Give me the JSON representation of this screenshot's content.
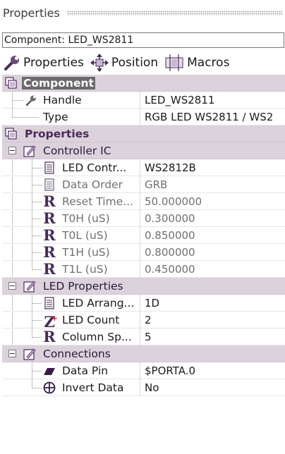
{
  "panel": {
    "title": "Properties"
  },
  "component_selector": {
    "value": "Component: LED_WS2811"
  },
  "tabs": [
    {
      "label": "Properties",
      "icon": "wrench-icon"
    },
    {
      "label": "Position",
      "icon": "move-arrows-icon"
    },
    {
      "label": "Macros",
      "icon": "macro-icon"
    }
  ],
  "component": {
    "label": "Component",
    "rows": [
      {
        "name": "Handle",
        "value": "LED_WS2811",
        "icon": "wrench-small-icon"
      },
      {
        "name": "Type",
        "value": "RGB LED WS2811 / WS2"
      }
    ]
  },
  "properties": {
    "label": "Properties",
    "groups": [
      {
        "label": "Controller IC",
        "rows": [
          {
            "name": "LED Contr...",
            "value": "WS2812B",
            "icon": "list-icon",
            "disabled": false
          },
          {
            "name": "Data Order",
            "value": "GRB",
            "icon": "list-icon",
            "disabled": true
          },
          {
            "name": "Reset Time...",
            "value": "50.000000",
            "icon": "real-icon",
            "disabled": true
          },
          {
            "name": "T0H (uS)",
            "value": "0.300000",
            "icon": "real-icon",
            "disabled": true
          },
          {
            "name": "T0L (uS)",
            "value": "0.850000",
            "icon": "real-icon",
            "disabled": true
          },
          {
            "name": "T1H (uS)",
            "value": "0.800000",
            "icon": "real-icon",
            "disabled": true
          },
          {
            "name": "T1L (uS)",
            "value": "0.450000",
            "icon": "real-icon",
            "disabled": true
          }
        ]
      },
      {
        "label": "LED Properties",
        "rows": [
          {
            "name": "LED Arrang...",
            "value": "1D",
            "icon": "list-icon",
            "disabled": false
          },
          {
            "name": "LED Count",
            "value": "2",
            "icon": "integer-icon",
            "disabled": false
          },
          {
            "name": "Column Sp...",
            "value": "5",
            "icon": "real-icon",
            "disabled": false
          }
        ]
      },
      {
        "label": "Connections",
        "rows": [
          {
            "name": "Data Pin",
            "value": "$PORTA.0",
            "icon": "pin-icon",
            "disabled": false
          },
          {
            "name": "Invert Data",
            "value": "No",
            "icon": "boolean-icon",
            "disabled": false
          }
        ]
      }
    ]
  },
  "glyphs": {
    "real": "R",
    "integer": "Z",
    "plus": "+"
  },
  "colors": {
    "section_bg": "#dcd2dc",
    "accent": "#4a2a5a",
    "selection": "#6a6a6a"
  }
}
